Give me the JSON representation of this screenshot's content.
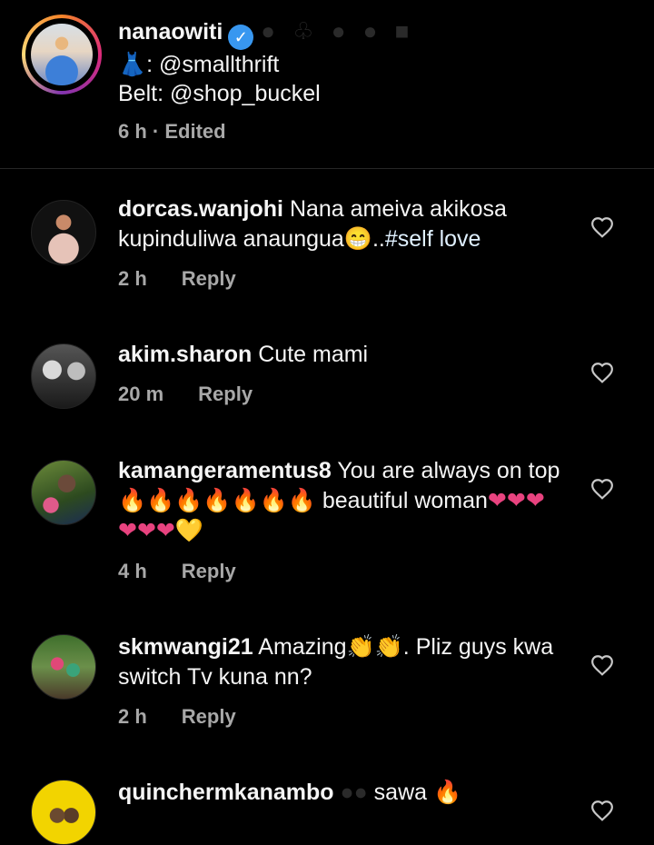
{
  "caption": {
    "username": "nanaowiti",
    "verified_glyph": "✓",
    "trailing_emojis": "● ♧ ● ● ■",
    "line1_emoji": "👗",
    "line1_text": ": @smallthrift",
    "line2_text": "Belt: @shop_buckel",
    "time": "6 h",
    "edited": "· Edited"
  },
  "comments": [
    {
      "username": "dorcas.wanjohi",
      "text": "Nana ameiva akikosa kupinduliwa anaungua😁..",
      "hashtag": "#self love",
      "time": "2 h",
      "reply": "Reply",
      "like_icon": "heart-outline-icon"
    },
    {
      "username": "akim.sharon",
      "text": "Cute mami",
      "time": "20 m",
      "reply": "Reply",
      "like_icon": "heart-outline-icon"
    },
    {
      "username": "kamangeramentus8",
      "text_a": "You are always on top",
      "fires": "🔥🔥🔥🔥🔥🔥🔥",
      "text_b": "beautiful woman",
      "hearts": "❤❤❤❤❤❤",
      "gold_heart": "💛",
      "time": "4 h",
      "reply": "Reply",
      "like_icon": "heart-outline-icon"
    },
    {
      "username": "skmwangi21",
      "text_a": "Amazing",
      "claps": "👏👏",
      "text_b": ". Pliz  guys kwa switch Tv kuna nn?",
      "time": "2 h",
      "reply": "Reply",
      "like_icon": "heart-outline-icon"
    },
    {
      "username": "quinchermkanambo",
      "dim_emojis": "●●",
      "text": "sawa",
      "fire": "🔥",
      "like_icon": "heart-outline-icon"
    }
  ],
  "colors": {
    "background": "#000000",
    "text": "#f5f5f5",
    "meta": "#a8a8a8",
    "verified": "#3897f0"
  }
}
